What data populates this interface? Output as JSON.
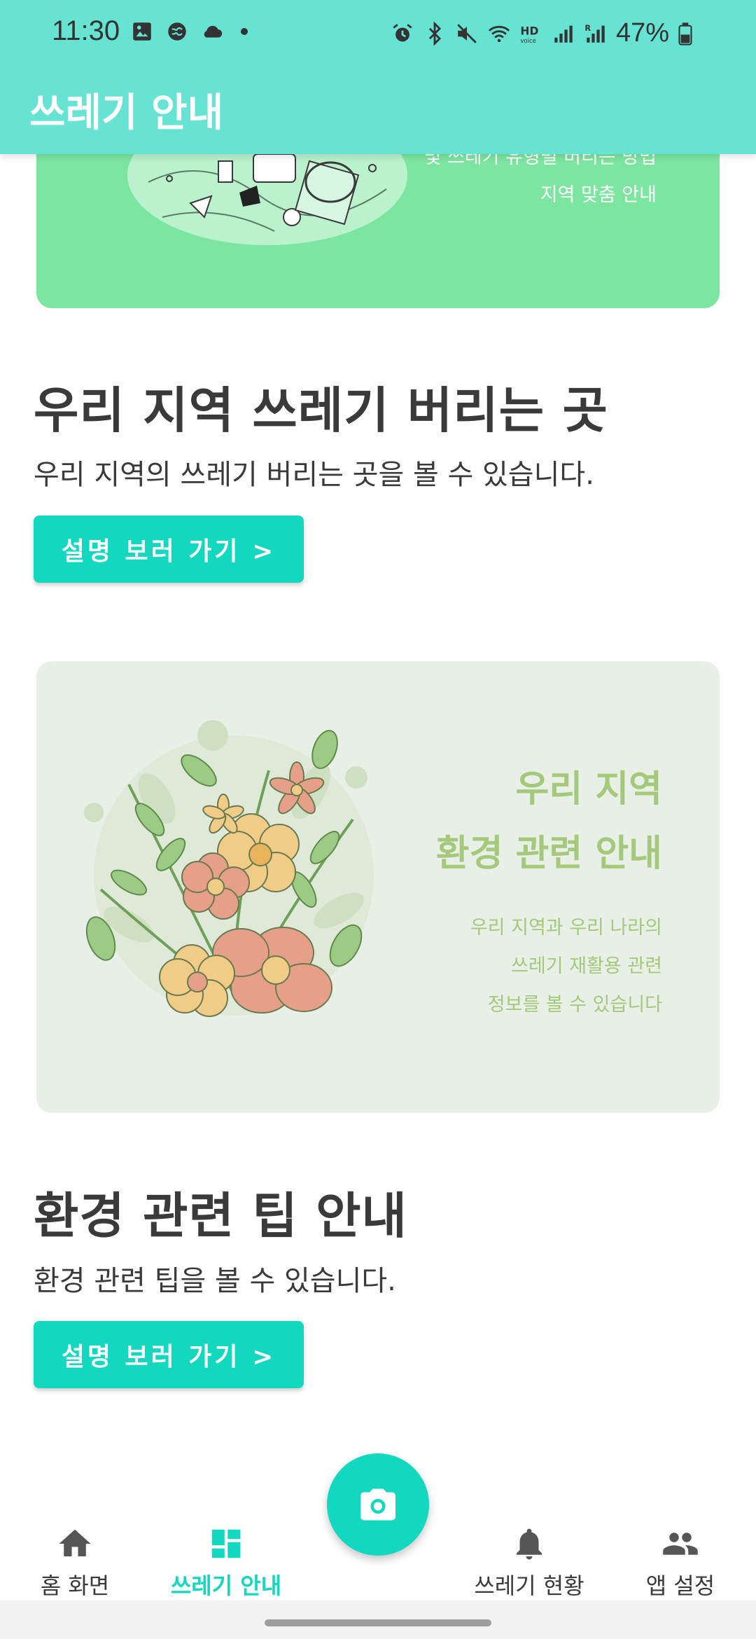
{
  "status_bar": {
    "time": "11:30",
    "battery_percent": "47%",
    "left_icons": [
      "gallery-icon",
      "brain-icon",
      "cloud-icon",
      "dot-icon"
    ],
    "right_icons": [
      "alarm-icon",
      "bluetooth-icon",
      "mute-icon",
      "wifi-icon",
      "hd-voice-icon",
      "signal-icon",
      "signal-roaming-icon",
      "battery-icon"
    ]
  },
  "app_bar": {
    "title": "쓰레기 안내"
  },
  "banner_top": {
    "line1": "및 쓰레기 유형별 버리는 방법",
    "line2": "지역 맞춤 안내",
    "color": "#7ce6a0"
  },
  "section_local": {
    "title": "우리 지역 쓰레기 버리는 곳",
    "description": "우리 지역의 쓰레기 버리는 곳을 볼 수 있습니다.",
    "button_label": "설명 보러 가기 >"
  },
  "banner_flower": {
    "heading1": "우리 지역",
    "heading2": "환경 관련 안내",
    "text1": "우리 지역과 우리 나라의",
    "text2": "쓰레기 재활용 관련",
    "text3": "정보를 볼 수 있습니다",
    "color": "#e8efe7"
  },
  "section_tips": {
    "title": "환경 관련 팁 안내",
    "description": "환경 관련 팁을 볼 수 있습니다.",
    "button_label": "설명 보러 가기 >"
  },
  "fab": {
    "icon": "camera-icon"
  },
  "bottom_nav": {
    "items": [
      {
        "label": "홈 화면",
        "icon": "home-icon",
        "active": false
      },
      {
        "label": "쓰레기 안내",
        "icon": "dashboard-icon",
        "active": true
      },
      {
        "label": "쓰레기 현황",
        "icon": "bell-icon",
        "active": false
      },
      {
        "label": "앱 설정",
        "icon": "people-icon",
        "active": false
      }
    ]
  },
  "colors": {
    "header": "#66e3d2",
    "accent": "#11d8bf",
    "text": "#3a3a3a"
  }
}
